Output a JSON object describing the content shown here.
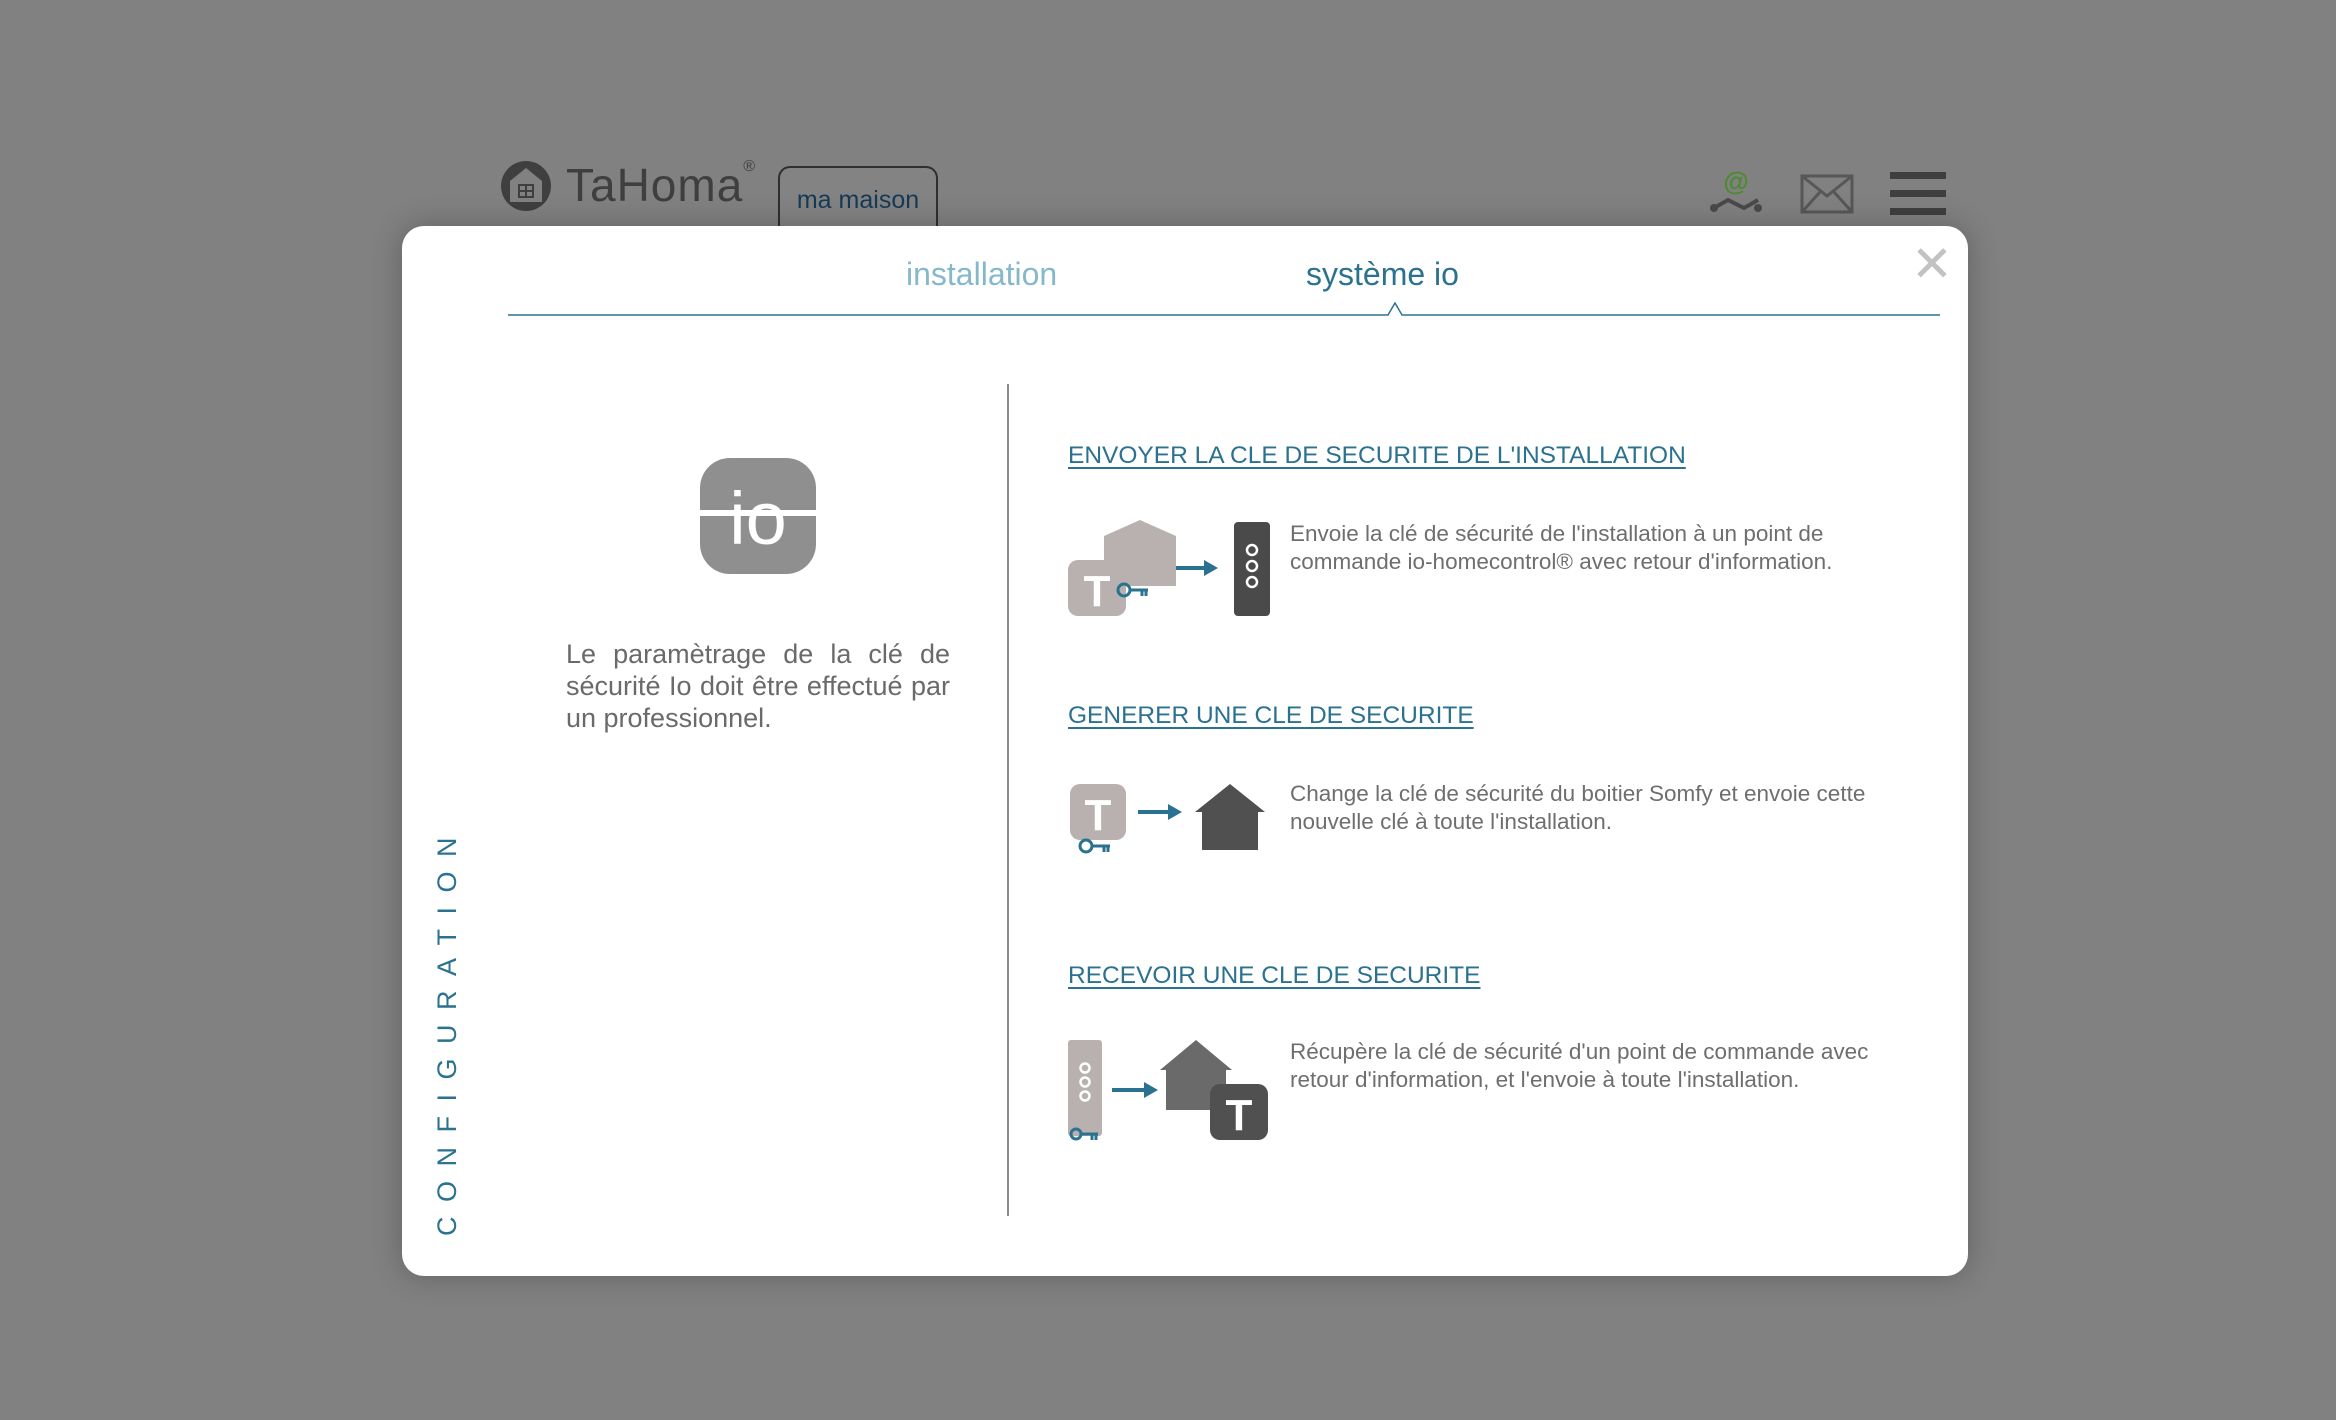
{
  "header": {
    "brand_name": "TaHoma",
    "brand_reg": "®",
    "home_tab": "ma maison",
    "icons": [
      "logo-house-icon",
      "internet-connection-icon",
      "mail-icon",
      "menu-icon"
    ]
  },
  "modal": {
    "close_label": "✕",
    "tabs": [
      {
        "label": "installation",
        "active": false
      },
      {
        "label": "système io",
        "active": true
      }
    ],
    "vertical_label": "CONFIGURATION",
    "io_logo_text": "io",
    "left_text": "Le paramètrage de la clé de sécurité Io doit être effectué par un professionnel.",
    "sections": [
      {
        "title": "ENVOYER LA CLE DE SECURITE DE L'INSTALLATION",
        "description": "Envoie la clé de sécurité de l'installation à un point de commande io-homecontrol® avec retour d'information.",
        "icon": "send-key-to-remote-icon"
      },
      {
        "title": "GENERER UNE CLE DE SECURITE",
        "description": "Change la clé de sécurité du boitier Somfy et envoie cette nouvelle clé à toute l'installation.",
        "icon": "generate-key-icon"
      },
      {
        "title": "RECEVOIR UNE CLE DE SECURITE",
        "description": "Récupère la clé de sécurité d'un point de commande avec retour d'information, et l'envoie à toute l'installation.",
        "icon": "receive-key-icon"
      }
    ]
  },
  "colors": {
    "backdrop": "#818181",
    "accent": "#2b7290",
    "accent_light": "#86b8cc",
    "text_gray": "#6e6e6e",
    "icon_dark": "#505050",
    "icon_light": "#b8b1af"
  }
}
